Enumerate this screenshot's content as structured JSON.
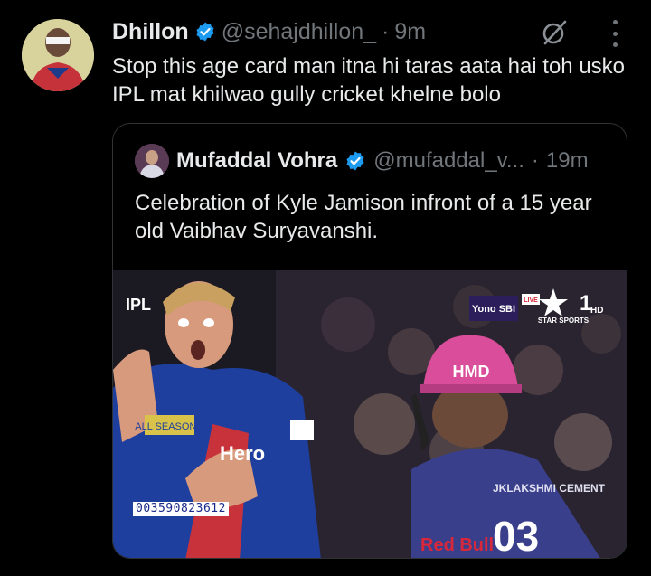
{
  "tweet": {
    "author_name": "Dhillon",
    "handle": "@sehajdhillon_",
    "separator": "·",
    "time": "9m",
    "text": "Stop this age card man itna hi taras aata hai toh usko IPL mat khilwao gully cricket khelne bolo",
    "verified": true,
    "icons": [
      "verified-badge-icon",
      "grok-icon",
      "more-options-icon"
    ]
  },
  "quoted": {
    "author_name": "Mufaddal Vohra",
    "handle": "@mufaddal_v...",
    "separator": "·",
    "time": "19m",
    "text": "Celebration of Kyle Jamison infront of a 15 year old Vaibhav Suryavanshi.",
    "verified": true,
    "media": {
      "broadcast_logo_left": "IPL",
      "sponsor_badge": "Yono SBI",
      "live_label": "LIVE",
      "channel_number": "1",
      "channel_hd": "HD",
      "channel_name": "STAR SPORTS",
      "helmet_text": "HMD",
      "jersey_sponsor_left": "ALL SEASONS",
      "jersey_text_left": "Hero",
      "jersey_name_right": "JKLAKSHMI CEMENT",
      "jersey_number_right": "03",
      "jersey_brand_right": "Red Bull",
      "barcode_text": "003590823612"
    }
  },
  "colors": {
    "background": "#000000",
    "primary_text": "#e7e9ea",
    "secondary_text": "#71767b",
    "verified_blue": "#1d9bf0",
    "border": "#2f3336"
  }
}
